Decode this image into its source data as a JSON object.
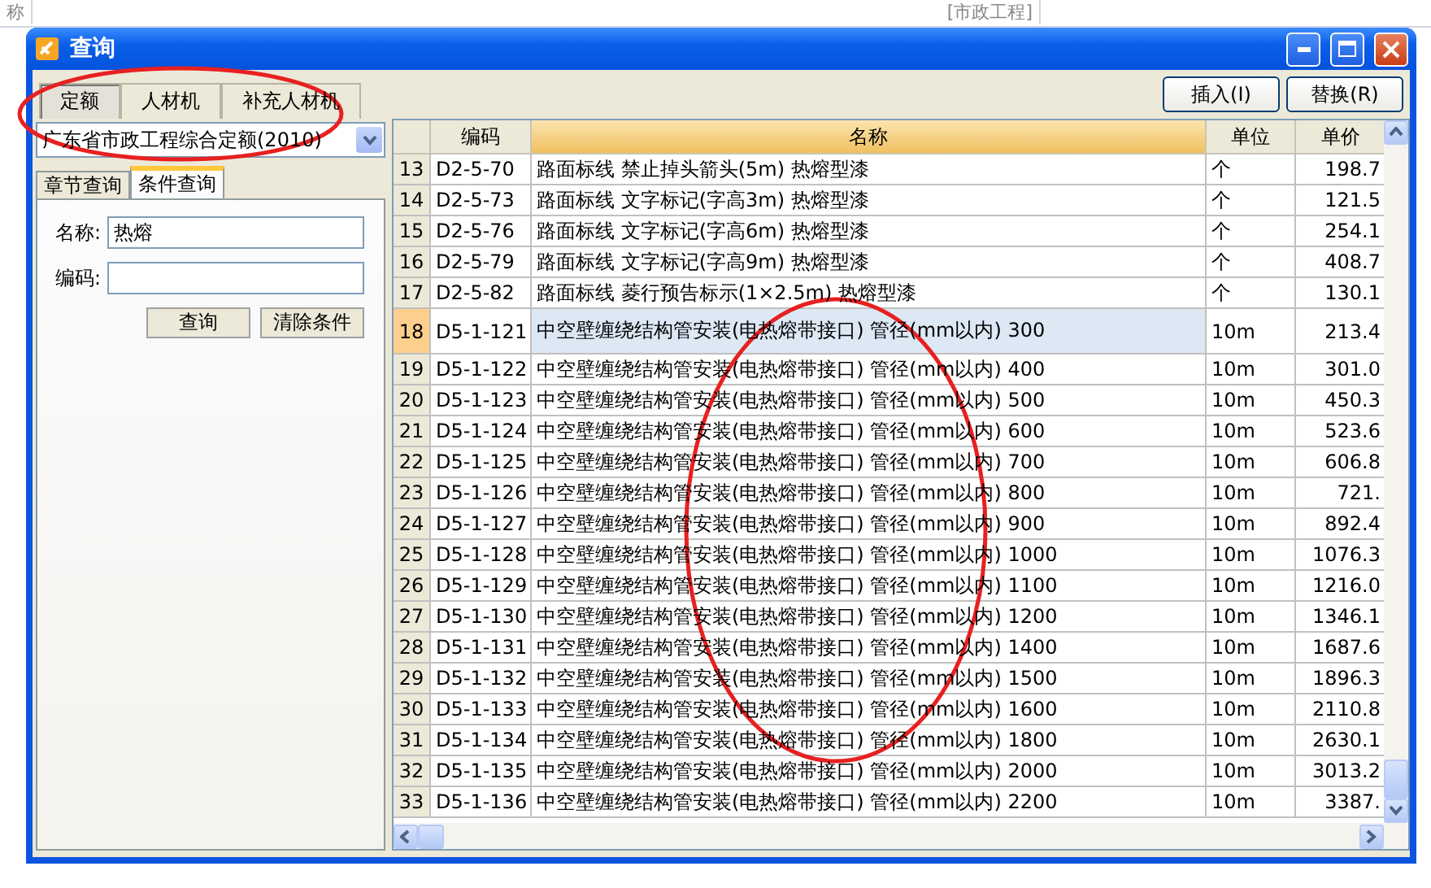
{
  "background": {
    "texts": [
      "称",
      "[市政工程]"
    ]
  },
  "window": {
    "title": "查询"
  },
  "tabs": [
    {
      "label": "定额",
      "selected": true
    },
    {
      "label": "人材机",
      "selected": false
    },
    {
      "label": "补充人材机",
      "selected": false
    }
  ],
  "library": {
    "value": "广东省市政工程综合定额(2010)"
  },
  "query_tabs": [
    {
      "label": "章节查询",
      "selected": false
    },
    {
      "label": "条件查询",
      "selected": true
    }
  ],
  "fields": [
    {
      "label": "名称:",
      "value": "热熔"
    },
    {
      "label": "编码:"
    }
  ],
  "query_buttons": [
    "查询",
    "清除条件"
  ],
  "action_buttons": [
    "插入(I)",
    "替换(R)"
  ],
  "table": {
    "columns": [
      {
        "label": "编码",
        "active": false
      },
      {
        "label": "名称",
        "active": true
      },
      {
        "label": "单位",
        "active": false
      },
      {
        "label": "单价",
        "active": false
      }
    ],
    "rows": [
      {
        "num": "13",
        "code": "D2-5-70",
        "name": "路面标线 禁止掉头箭头(5m) 热熔型漆",
        "unit": "个",
        "price": "198.7",
        "selected": false
      },
      {
        "num": "14",
        "code": "D2-5-73",
        "name": "路面标线 文字标记(字高3m) 热熔型漆",
        "unit": "个",
        "price": "121.5",
        "selected": false
      },
      {
        "num": "15",
        "code": "D2-5-76",
        "name": "路面标线 文字标记(字高6m) 热熔型漆",
        "unit": "个",
        "price": "254.1",
        "selected": false
      },
      {
        "num": "16",
        "code": "D2-5-79",
        "name": "路面标线 文字标记(字高9m) 热熔型漆",
        "unit": "个",
        "price": "408.7",
        "selected": false
      },
      {
        "num": "17",
        "code": "D2-5-82",
        "name": "路面标线 菱行预告标示(1×2.5m) 热熔型漆",
        "unit": "个",
        "price": "130.1",
        "selected": false
      },
      {
        "num": "18",
        "code": "D5-1-121",
        "name": "中空壁缠绕结构管安装(电热熔带接口) 管径(mm以内) 300",
        "unit": "10m",
        "price": "213.4",
        "selected": true
      },
      {
        "num": "19",
        "code": "D5-1-122",
        "name": "中空壁缠绕结构管安装(电热熔带接口) 管径(mm以内) 400",
        "unit": "10m",
        "price": "301.0",
        "selected": false
      },
      {
        "num": "20",
        "code": "D5-1-123",
        "name": "中空壁缠绕结构管安装(电热熔带接口) 管径(mm以内) 500",
        "unit": "10m",
        "price": "450.3",
        "selected": false
      },
      {
        "num": "21",
        "code": "D5-1-124",
        "name": "中空壁缠绕结构管安装(电热熔带接口) 管径(mm以内) 600",
        "unit": "10m",
        "price": "523.6",
        "selected": false
      },
      {
        "num": "22",
        "code": "D5-1-125",
        "name": "中空壁缠绕结构管安装(电热熔带接口) 管径(mm以内) 700",
        "unit": "10m",
        "price": "606.8",
        "selected": false
      },
      {
        "num": "23",
        "code": "D5-1-126",
        "name": "中空壁缠绕结构管安装(电热熔带接口) 管径(mm以内) 800",
        "unit": "10m",
        "price": "721.",
        "selected": false
      },
      {
        "num": "24",
        "code": "D5-1-127",
        "name": "中空壁缠绕结构管安装(电热熔带接口) 管径(mm以内) 900",
        "unit": "10m",
        "price": "892.4",
        "selected": false
      },
      {
        "num": "25",
        "code": "D5-1-128",
        "name": "中空壁缠绕结构管安装(电热熔带接口) 管径(mm以内) 1000",
        "unit": "10m",
        "price": "1076.3",
        "selected": false
      },
      {
        "num": "26",
        "code": "D5-1-129",
        "name": "中空壁缠绕结构管安装(电热熔带接口) 管径(mm以内) 1100",
        "unit": "10m",
        "price": "1216.0",
        "selected": false
      },
      {
        "num": "27",
        "code": "D5-1-130",
        "name": "中空壁缠绕结构管安装(电热熔带接口) 管径(mm以内) 1200",
        "unit": "10m",
        "price": "1346.1",
        "selected": false
      },
      {
        "num": "28",
        "code": "D5-1-131",
        "name": "中空壁缠绕结构管安装(电热熔带接口) 管径(mm以内) 1400",
        "unit": "10m",
        "price": "1687.6",
        "selected": false
      },
      {
        "num": "29",
        "code": "D5-1-132",
        "name": "中空壁缠绕结构管安装(电热熔带接口) 管径(mm以内) 1500",
        "unit": "10m",
        "price": "1896.3",
        "selected": false
      },
      {
        "num": "30",
        "code": "D5-1-133",
        "name": "中空壁缠绕结构管安装(电热熔带接口) 管径(mm以内) 1600",
        "unit": "10m",
        "price": "2110.8",
        "selected": false
      },
      {
        "num": "31",
        "code": "D5-1-134",
        "name": "中空壁缠绕结构管安装(电热熔带接口) 管径(mm以内) 1800",
        "unit": "10m",
        "price": "2630.1",
        "selected": false
      },
      {
        "num": "32",
        "code": "D5-1-135",
        "name": "中空壁缠绕结构管安装(电热熔带接口) 管径(mm以内) 2000",
        "unit": "10m",
        "price": "3013.2",
        "selected": false
      },
      {
        "num": "33",
        "code": "D5-1-136",
        "name": "中空壁缠绕结构管安装(电热熔带接口) 管径(mm以内) 2200",
        "unit": "10m",
        "price": "3387.",
        "selected": false
      }
    ]
  }
}
